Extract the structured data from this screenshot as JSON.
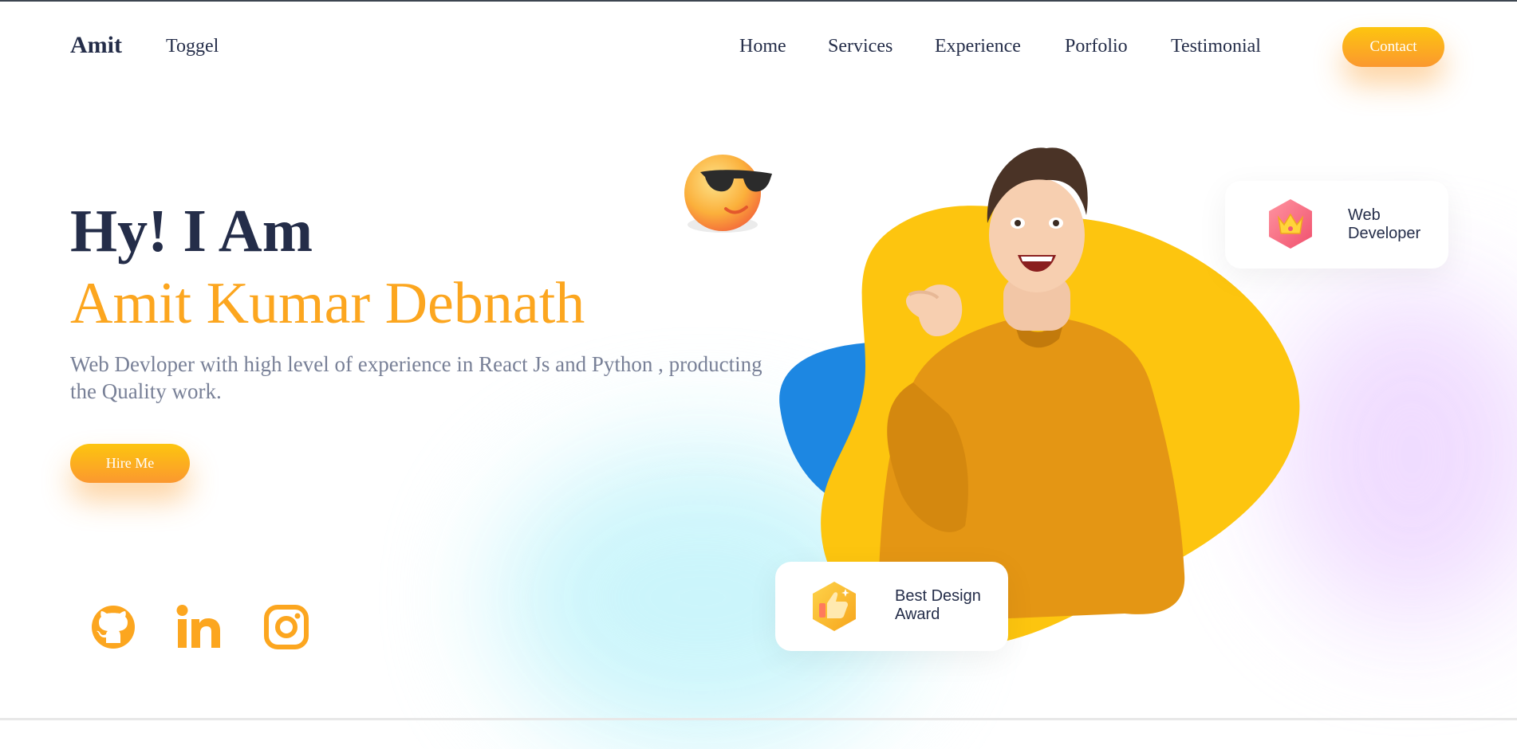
{
  "navbar": {
    "logo": "Amit",
    "toggle_label": "Toggel",
    "links": [
      "Home",
      "Services",
      "Experience",
      "Porfolio",
      "Testimonial"
    ],
    "contact_label": "Contact"
  },
  "hero": {
    "greeting": "Hy! I Am",
    "name": "Amit Kumar Debnath",
    "description": "Web Devloper with high level of experience in React Js and Python , producting the Quality work.",
    "hire_label": "Hire Me"
  },
  "social": [
    "github-icon",
    "linkedin-icon",
    "instagram-icon"
  ],
  "cards": {
    "web": {
      "line1": "Web",
      "line2": "Developer",
      "icon": "crown-icon"
    },
    "award": {
      "line1": "Best Design",
      "line2": "Award",
      "icon": "thumbs-up-icon"
    }
  },
  "colors": {
    "accent": "#fca61f",
    "heading": "#242d49",
    "text": "#788097",
    "blob_yellow": "#fdc50f",
    "blob_blue": "#1d87e2"
  }
}
